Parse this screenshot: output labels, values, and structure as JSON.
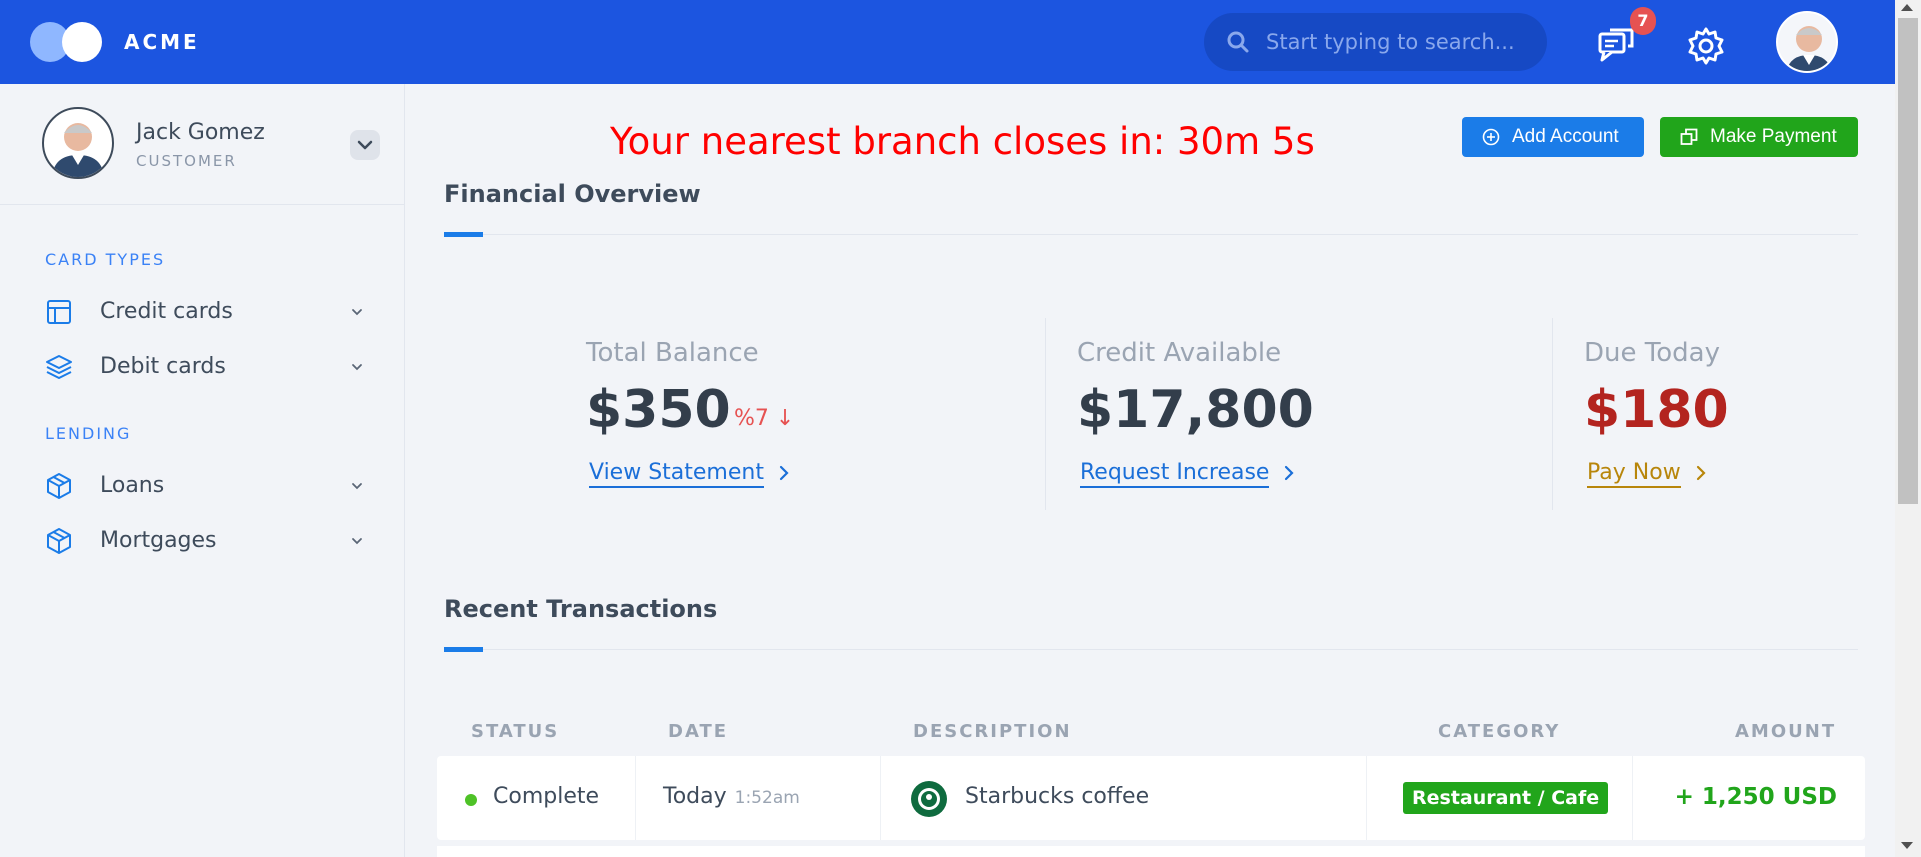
{
  "app": {
    "brand": "ACME"
  },
  "header": {
    "search_placeholder": "Start typing to search...",
    "notification_count": "7",
    "icons": [
      "search-icon",
      "chat-icon",
      "gear-icon",
      "user-avatar"
    ]
  },
  "user": {
    "name": "Jack Gomez",
    "role": "CUSTOMER"
  },
  "sidebar": {
    "sections": [
      {
        "title": "CARD TYPES",
        "items": [
          {
            "label": "Credit cards",
            "icon": "layout-icon"
          },
          {
            "label": "Debit cards",
            "icon": "layers-icon"
          }
        ]
      },
      {
        "title": "LENDING",
        "items": [
          {
            "label": "Loans",
            "icon": "box-icon"
          },
          {
            "label": "Mortgages",
            "icon": "box-icon"
          }
        ]
      }
    ]
  },
  "banner": {
    "text": "Your nearest branch closes in: 30m 5s"
  },
  "actions": {
    "add_account": "Add Account",
    "make_payment": "Make Payment"
  },
  "overview": {
    "title": "Financial Overview",
    "stats": [
      {
        "label": "Total Balance",
        "value": "$350",
        "delta": "%7 ↓",
        "link": "View Statement",
        "value_color": "#333e4b",
        "link_color": "#1b6fd8"
      },
      {
        "label": "Credit Available",
        "value": "$17,800",
        "link": "Request Increase",
        "value_color": "#333e4b",
        "link_color": "#1b6fd8"
      },
      {
        "label": "Due Today",
        "value": "$180",
        "link": "Pay Now",
        "value_color": "#b3241f",
        "link_color": "#b8860b"
      }
    ]
  },
  "transactions": {
    "title": "Recent Transactions",
    "columns": [
      "STATUS",
      "DATE",
      "DESCRIPTION",
      "CATEGORY",
      "AMOUNT"
    ],
    "rows": [
      {
        "status": "Complete",
        "date": "Today",
        "time": "1:52am",
        "description": "Starbucks coffee",
        "category": "Restaurant / Cafe",
        "amount": "+ 1,250 USD"
      }
    ]
  },
  "colors": {
    "primary": "#1c55e0",
    "accent_blue": "#1b7ce8",
    "success": "#21a51b",
    "danger": "#e65252",
    "banner_red": "#ff0000"
  }
}
